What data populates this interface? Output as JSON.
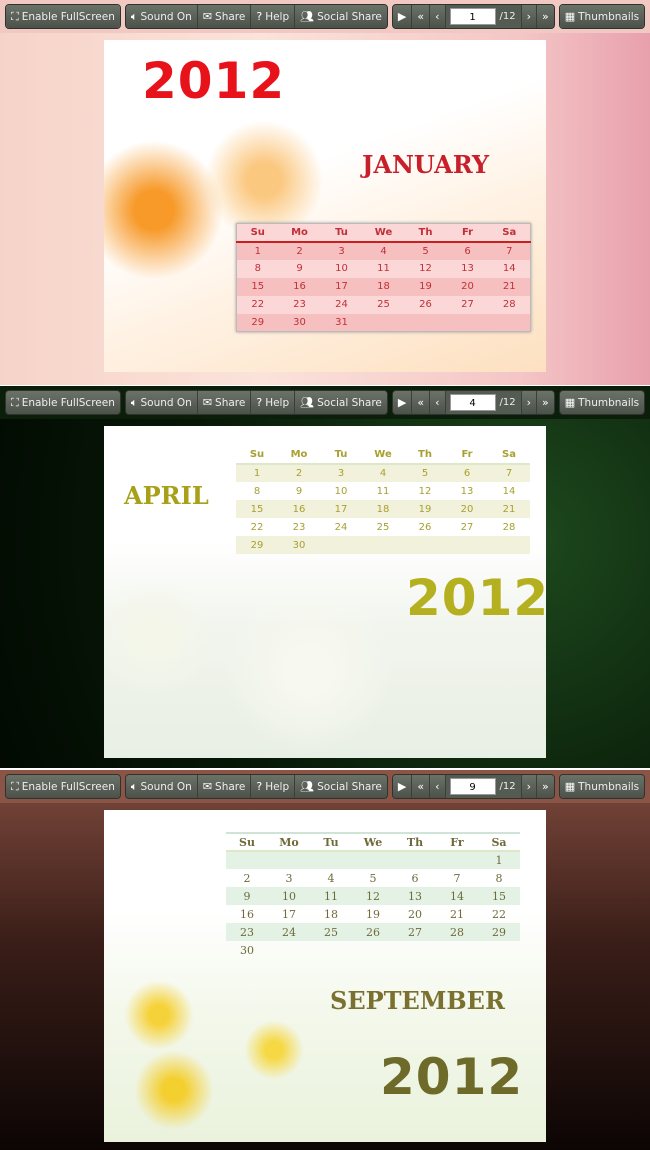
{
  "toolbar": {
    "fullscreen_label": "Enable FullScreen",
    "sound_label": "Sound On",
    "share_label": "Share",
    "help_label": "Help",
    "social_share_label": "Social Share",
    "total_pages": "/12",
    "thumbnails_label": "Thumbnails"
  },
  "weekdays": [
    "Su",
    "Mo",
    "Tu",
    "We",
    "Th",
    "Fr",
    "Sa"
  ],
  "panels": [
    {
      "current_page": "1",
      "year": "2012",
      "month": "JANUARY",
      "colors": {
        "year": "#e8121a",
        "month": "#c8202a",
        "calendar_text": "#c03038",
        "calendar_bg": "#f7c0c0"
      },
      "weeks": [
        [
          "1",
          "2",
          "3",
          "4",
          "5",
          "6",
          "7"
        ],
        [
          "8",
          "9",
          "10",
          "11",
          "12",
          "13",
          "14"
        ],
        [
          "15",
          "16",
          "17",
          "18",
          "19",
          "20",
          "21"
        ],
        [
          "22",
          "23",
          "24",
          "25",
          "26",
          "27",
          "28"
        ],
        [
          "29",
          "30",
          "31",
          "",
          "",
          "",
          ""
        ]
      ]
    },
    {
      "current_page": "4",
      "year": "2012",
      "month": "APRIL",
      "colors": {
        "year": "#b5b020",
        "month": "#a8a018",
        "calendar_text": "#a8a030",
        "calendar_bg": "#f2f2dc"
      },
      "weeks": [
        [
          "1",
          "2",
          "3",
          "4",
          "5",
          "6",
          "7"
        ],
        [
          "8",
          "9",
          "10",
          "11",
          "12",
          "13",
          "14"
        ],
        [
          "15",
          "16",
          "17",
          "18",
          "19",
          "20",
          "21"
        ],
        [
          "22",
          "23",
          "24",
          "25",
          "26",
          "27",
          "28"
        ],
        [
          "29",
          "30",
          "",
          "",
          "",
          "",
          ""
        ]
      ]
    },
    {
      "current_page": "9",
      "year": "2012",
      "month": "SEPTEMBER",
      "colors": {
        "year": "#6e6a2a",
        "month": "#7a7030",
        "calendar_text": "#6e6a3a",
        "calendar_bg": "#e4f2e6"
      },
      "weeks": [
        [
          "",
          "",
          "",
          "",
          "",
          "",
          "1"
        ],
        [
          "2",
          "3",
          "4",
          "5",
          "6",
          "7",
          "8"
        ],
        [
          "9",
          "10",
          "11",
          "12",
          "13",
          "14",
          "15"
        ],
        [
          "16",
          "17",
          "18",
          "19",
          "20",
          "21",
          "22"
        ],
        [
          "23",
          "24",
          "25",
          "26",
          "27",
          "28",
          "29"
        ],
        [
          "30",
          "",
          "",
          "",
          "",
          "",
          ""
        ]
      ]
    }
  ]
}
